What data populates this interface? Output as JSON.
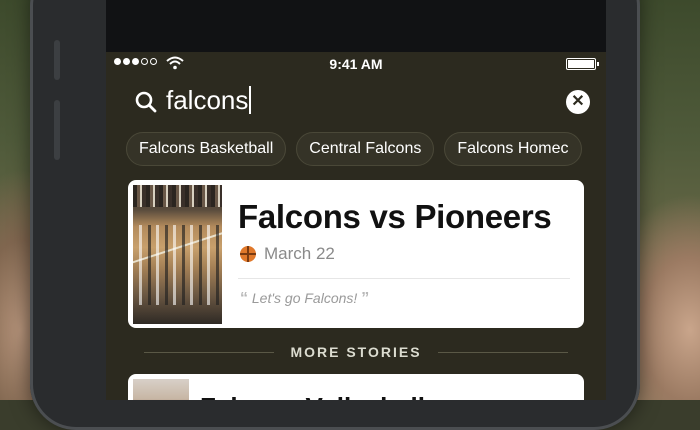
{
  "status_bar": {
    "time": "9:41 AM"
  },
  "search": {
    "query": "falcons"
  },
  "suggestions": [
    {
      "label": "Falcons Basketball"
    },
    {
      "label": "Central Falcons"
    },
    {
      "label": "Falcons Homec"
    }
  ],
  "featured_story": {
    "title": "Falcons vs Pioneers",
    "date": "March 22",
    "quote": "Let's go Falcons!",
    "icon": "basketball-icon"
  },
  "more_stories": {
    "header": "MORE STORIES",
    "items": [
      {
        "title": "Falcons Volleyball"
      }
    ]
  },
  "colors": {
    "accent": "#e0782a",
    "screen_bg": "#2c2a1f",
    "card_bg": "#ffffff"
  }
}
